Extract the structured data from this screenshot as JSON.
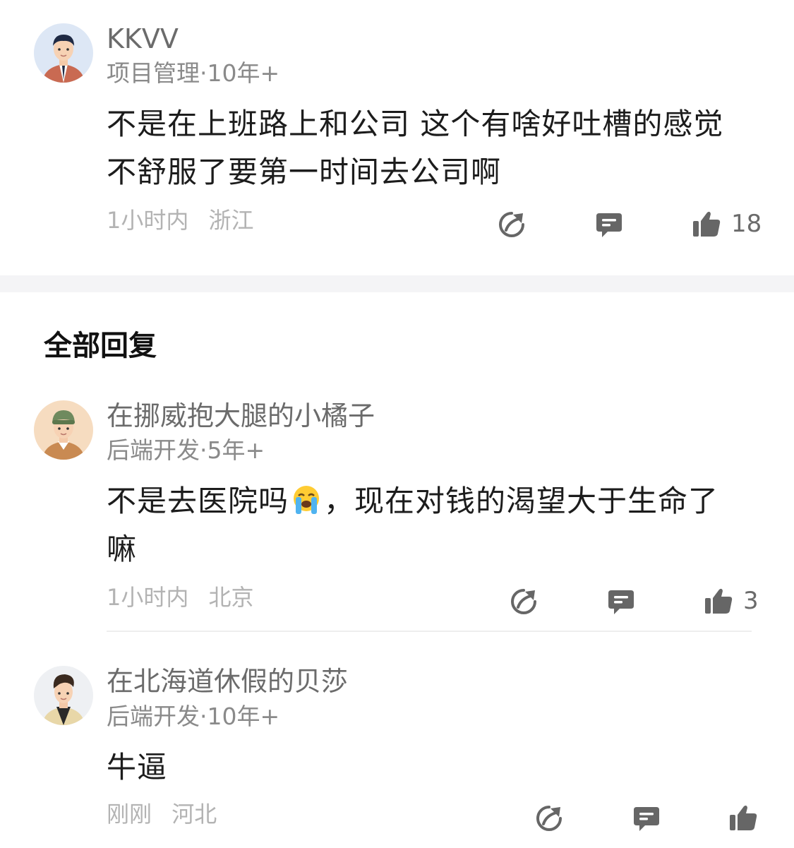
{
  "main_comment": {
    "username": "KKVV",
    "subtitle": "项目管理·10年+",
    "content": "不是在上班路上和公司 这个有啥好吐槽的感觉不舒服了要第一时间去公司啊",
    "time": "1小时内",
    "location": "浙江",
    "likes": "18",
    "avatar_icon": "man-in-suit-avatar"
  },
  "section_title": "全部回复",
  "replies": [
    {
      "username": "在挪威抱大腿的小橘子",
      "subtitle": "后端开发·5年+",
      "content_before": "不是去医院吗",
      "emoji": "crying-face-emoji",
      "content_after": "，现在对钱的渴望大于生命了嘛",
      "time": "1小时内",
      "location": "北京",
      "likes": "3",
      "avatar_icon": "boy-with-beanie-avatar"
    },
    {
      "username": "在北海道休假的贝莎",
      "subtitle": "后端开发·10年+",
      "content": "牛逼",
      "time": "刚刚",
      "location": "河北",
      "likes": "",
      "avatar_icon": "stylish-man-avatar"
    }
  ],
  "colors": {
    "icon_gray": "#666666",
    "meta_gray": "#b3b3b3",
    "separator": "#f4f4f6"
  }
}
